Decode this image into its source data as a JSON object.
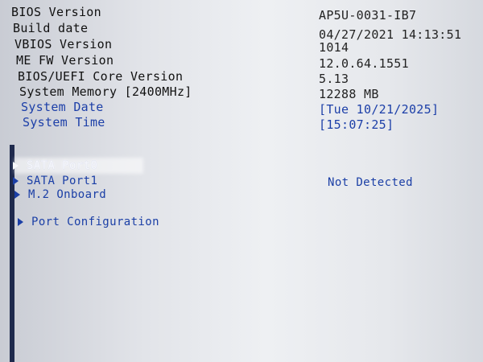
{
  "info": {
    "bios_version": {
      "label": "BIOS Version",
      "value": "AP5U-0031-IB7"
    },
    "build_date": {
      "label": "Build date",
      "value": "04/27/2021 14:13:51"
    },
    "vbios_version": {
      "label": "VBIOS Version",
      "value": "1014"
    },
    "me_fw_version": {
      "label": "ME FW Version",
      "value": "12.0.64.1551"
    },
    "core_version": {
      "label": "BIOS/UEFI Core Version",
      "value": "5.13"
    },
    "system_memory": {
      "label": "System Memory [2400MHz]",
      "value": "12288 MB"
    },
    "system_date": {
      "label": "System Date",
      "value": "[Tue 10/21/2025]"
    },
    "system_time": {
      "label": "System Time",
      "value": "[15:07:25]"
    }
  },
  "menu": {
    "sata_port0": {
      "label": "SATA Port0",
      "icon": "triangle-right-icon"
    },
    "sata_port1": {
      "label": "SATA Port1",
      "icon": "triangle-right-icon",
      "status": "Not Detected"
    },
    "m2_onboard": {
      "label": "M.2 Onboard",
      "icon": "triangle-right-icon"
    },
    "port_configuration": {
      "label": "Port Configuration",
      "icon": "triangle-right-icon"
    }
  },
  "colors": {
    "editable_text": "#1c3fa8",
    "static_text": "#111111",
    "background": "#e6e8ec"
  }
}
